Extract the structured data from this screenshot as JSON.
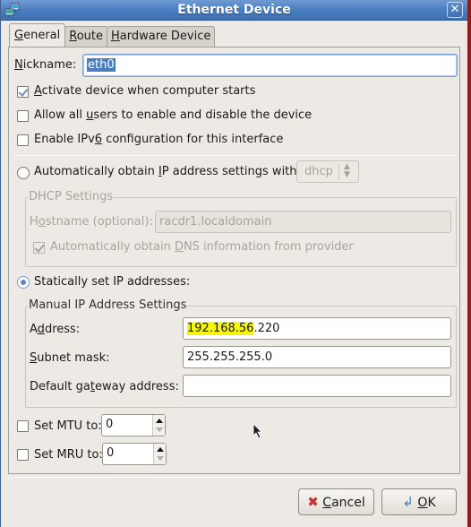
{
  "window": {
    "title": "Ethernet Device",
    "app_icon": "network-device-icon",
    "close_icon": "close-icon"
  },
  "tabs": [
    {
      "label": "General",
      "mnemonic": "G",
      "rest": "eneral",
      "active": true
    },
    {
      "label": "Route",
      "mnemonic": "R",
      "rest": "oute",
      "active": false
    },
    {
      "label": "Hardware Device",
      "mnemonic": "H",
      "rest": "ardware Device",
      "active": false
    }
  ],
  "general": {
    "nickname": {
      "label_m": "N",
      "label_rest": "ickname:",
      "value": "eth0"
    },
    "activate_on_boot": {
      "pre": "",
      "m": "A",
      "post": "ctivate device when computer starts",
      "checked": true
    },
    "allow_all_users": {
      "pre": "Allow all ",
      "m": "u",
      "post": "sers to enable and disable the device",
      "checked": false
    },
    "enable_ipv6": {
      "pre": "Enable IPv",
      "m": "6",
      "post": " configuration for this interface",
      "checked": false
    },
    "auto_ip": {
      "pre": "Automatically obtain ",
      "m": "I",
      "post": "P address settings with:",
      "selected": false,
      "method": "dhcp"
    },
    "dhcp_settings": {
      "title": "DHCP Settings",
      "hostname_pre": "H",
      "hostname_m": "o",
      "hostname_post": "stname (optional):",
      "hostname_value": "racdr1.localdomain",
      "auto_dns_pre": "Automatically obtain ",
      "auto_dns_m": "D",
      "auto_dns_post": "NS information from provider",
      "auto_dns_checked": true
    },
    "static_ip": {
      "label": "Statically set IP addresses:",
      "selected": true
    },
    "manual_settings": {
      "title": "Manual IP Address Settings",
      "address_pre": "A",
      "address_m": "d",
      "address_post": "dress:",
      "address_highlight": "192.168.56",
      "address_rest": ".220",
      "subnet_m": "S",
      "subnet_post": "ubnet mask:",
      "subnet_value": "255.255.255.0",
      "gateway_pre": "Default ga",
      "gateway_m": "t",
      "gateway_post": "eway address:",
      "gateway_value": ""
    },
    "mtu": {
      "label": "Set MTU to:",
      "checked": false,
      "value": "0"
    },
    "mru": {
      "label": "Set MRU to:",
      "checked": false,
      "value": "0"
    }
  },
  "buttons": {
    "cancel": {
      "m": "C",
      "rest": "ancel",
      "icon": "cancel-x-icon"
    },
    "ok": {
      "m": "O",
      "rest": "K",
      "icon": "ok-arrow-icon"
    }
  }
}
